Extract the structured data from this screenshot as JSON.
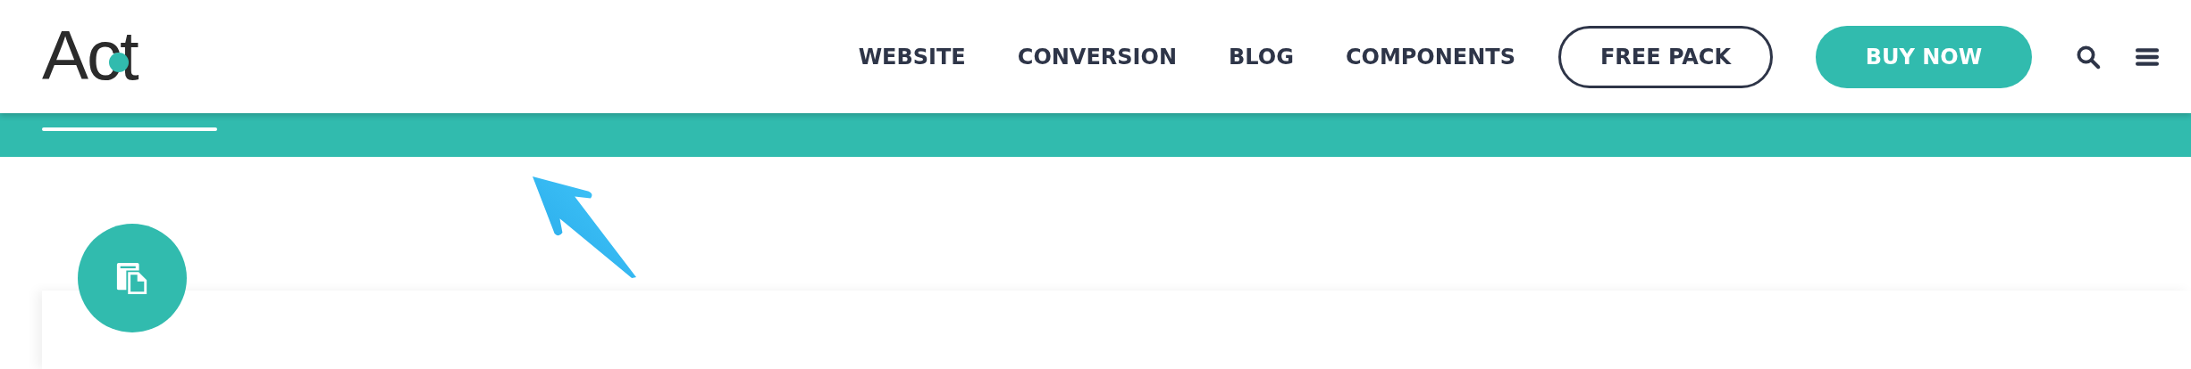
{
  "header": {
    "logo": "Act",
    "nav": [
      {
        "label": "WEBSITE"
      },
      {
        "label": "CONVERSION"
      },
      {
        "label": "BLOG"
      },
      {
        "label": "COMPONENTS"
      }
    ],
    "buttons": [
      {
        "label": "FREE PACK",
        "kind": "outline"
      },
      {
        "label": "BUY NOW",
        "kind": "filled"
      }
    ]
  }
}
